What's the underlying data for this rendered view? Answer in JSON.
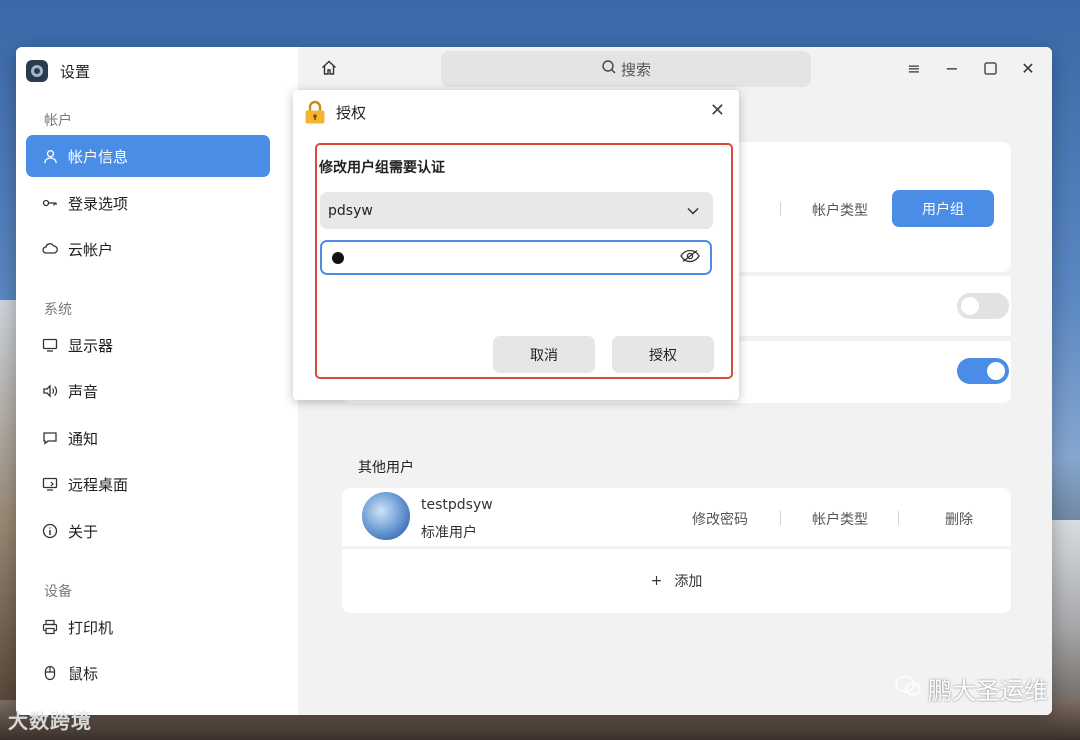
{
  "app": {
    "title": "设置"
  },
  "search": {
    "label": "搜索"
  },
  "sidebar": {
    "groups": [
      {
        "label": "帐户"
      },
      {
        "label": "系统"
      },
      {
        "label": "设备"
      }
    ],
    "items": [
      {
        "label": "帐户信息",
        "icon": "user-icon",
        "active": true
      },
      {
        "label": "登录选项",
        "icon": "key-icon"
      },
      {
        "label": "云帐户",
        "icon": "cloud-icon"
      },
      {
        "label": "显示器",
        "icon": "monitor-icon"
      },
      {
        "label": "声音",
        "icon": "speaker-icon"
      },
      {
        "label": "通知",
        "icon": "message-icon"
      },
      {
        "label": "远程桌面",
        "icon": "remote-desktop-icon"
      },
      {
        "label": "关于",
        "icon": "info-icon"
      },
      {
        "label": "打印机",
        "icon": "printer-icon"
      },
      {
        "label": "鼠标",
        "icon": "mouse-icon"
      }
    ]
  },
  "current_user": {
    "account_type_link": "帐户类型",
    "user_group_button": "用户组",
    "toggle_1": false,
    "toggle_2": true
  },
  "other_users": {
    "title": "其他用户",
    "users": [
      {
        "name": "testpdsyw",
        "type": "标准用户",
        "change_password": "修改密码",
        "account_type": "帐户类型",
        "delete": "删除"
      }
    ],
    "add_label": "添加"
  },
  "auth_dialog": {
    "title": "授权",
    "heading": "修改用户组需要认证",
    "selected_user": "pdsyw",
    "cancel_label": "取消",
    "confirm_label": "授权"
  },
  "watermarks": {
    "left": "大数跨境",
    "right": "鹏大圣运维"
  },
  "colors": {
    "accent": "#4a8de6",
    "highlight_frame": "#dd4a3a"
  }
}
